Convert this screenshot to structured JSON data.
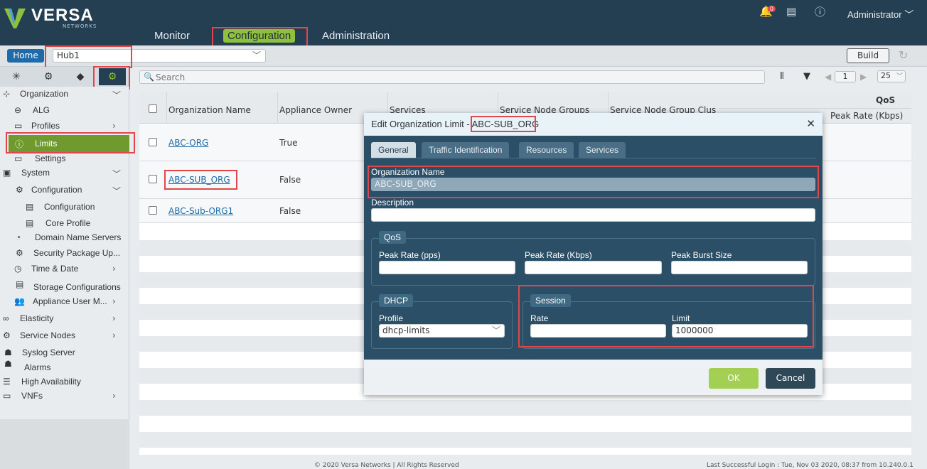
{
  "brand": {
    "name": "VERSA",
    "sub": "NETWORKS"
  },
  "nav": {
    "monitor": "Monitor",
    "configuration": "Configuration",
    "administration": "Administration"
  },
  "header": {
    "notification_count": "0",
    "user": "Administrator"
  },
  "subbar": {
    "home": "Home",
    "appliance": "Hub1",
    "build": "Build"
  },
  "toolbar": {
    "search_placeholder": "Search",
    "page": "1",
    "page_size": "25"
  },
  "sidebar": {
    "organization": "Organization",
    "alg": "ALG",
    "profiles": "Profiles",
    "limits": "Limits",
    "settings": "Settings",
    "system": "System",
    "configuration": "Configuration",
    "configuration_sub": "Configuration",
    "core_profile": "Core Profile",
    "dns": "Domain Name Servers",
    "security_package": "Security Package Up...",
    "time_date": "Time & Date",
    "storage": "Storage Configurations",
    "appliance_user": "Appliance User M...",
    "elasticity": "Elasticity",
    "service_nodes": "Service Nodes",
    "syslog": "Syslog Server",
    "alarms": "Alarms",
    "ha": "High Availability",
    "vnfs": "VNFs"
  },
  "grid": {
    "qos_group": "QoS",
    "columns": [
      "Organization Name",
      "Appliance Owner",
      "Services",
      "Service Node Groups",
      "Service Node Group Clus",
      "Peak Rate (Kbps)"
    ],
    "rows": [
      {
        "name": "ABC-ORG",
        "owner": "True"
      },
      {
        "name": "ABC-SUB_ORG",
        "owner": "False"
      },
      {
        "name": "ABC-Sub-ORG1",
        "owner": "False"
      }
    ]
  },
  "modal": {
    "title": "Edit Organization Limit - ",
    "title_org": "ABC-SUB_ORG",
    "tabs": [
      "General",
      "Traffic Identification",
      "Resources",
      "Services"
    ],
    "org_name_label": "Organization Name",
    "org_name_value": "ABC-SUB_ORG",
    "description_label": "Description",
    "description_value": "",
    "qos": {
      "legend": "QoS",
      "peak_rate_pps": "Peak Rate (pps)",
      "peak_rate_kbps": "Peak Rate (Kbps)",
      "peak_burst": "Peak Burst Size"
    },
    "dhcp": {
      "legend": "DHCP",
      "profile_label": "Profile",
      "profile_value": "dhcp-limits"
    },
    "session": {
      "legend": "Session",
      "rate_label": "Rate",
      "rate_value": "",
      "limit_label": "Limit",
      "limit_value": "1000000"
    },
    "ok": "OK",
    "cancel": "Cancel"
  },
  "footer": {
    "copyright": "© 2020 Versa Networks | All Rights Reserved",
    "last_login": "Last Successful Login : Tue, Nov 03 2020, 08:37 from 10.240.0.1"
  },
  "colors": {
    "accent": "#8fbf3e",
    "header": "#243e52",
    "highlight": "#e0464a",
    "link": "#1f6aa8"
  }
}
